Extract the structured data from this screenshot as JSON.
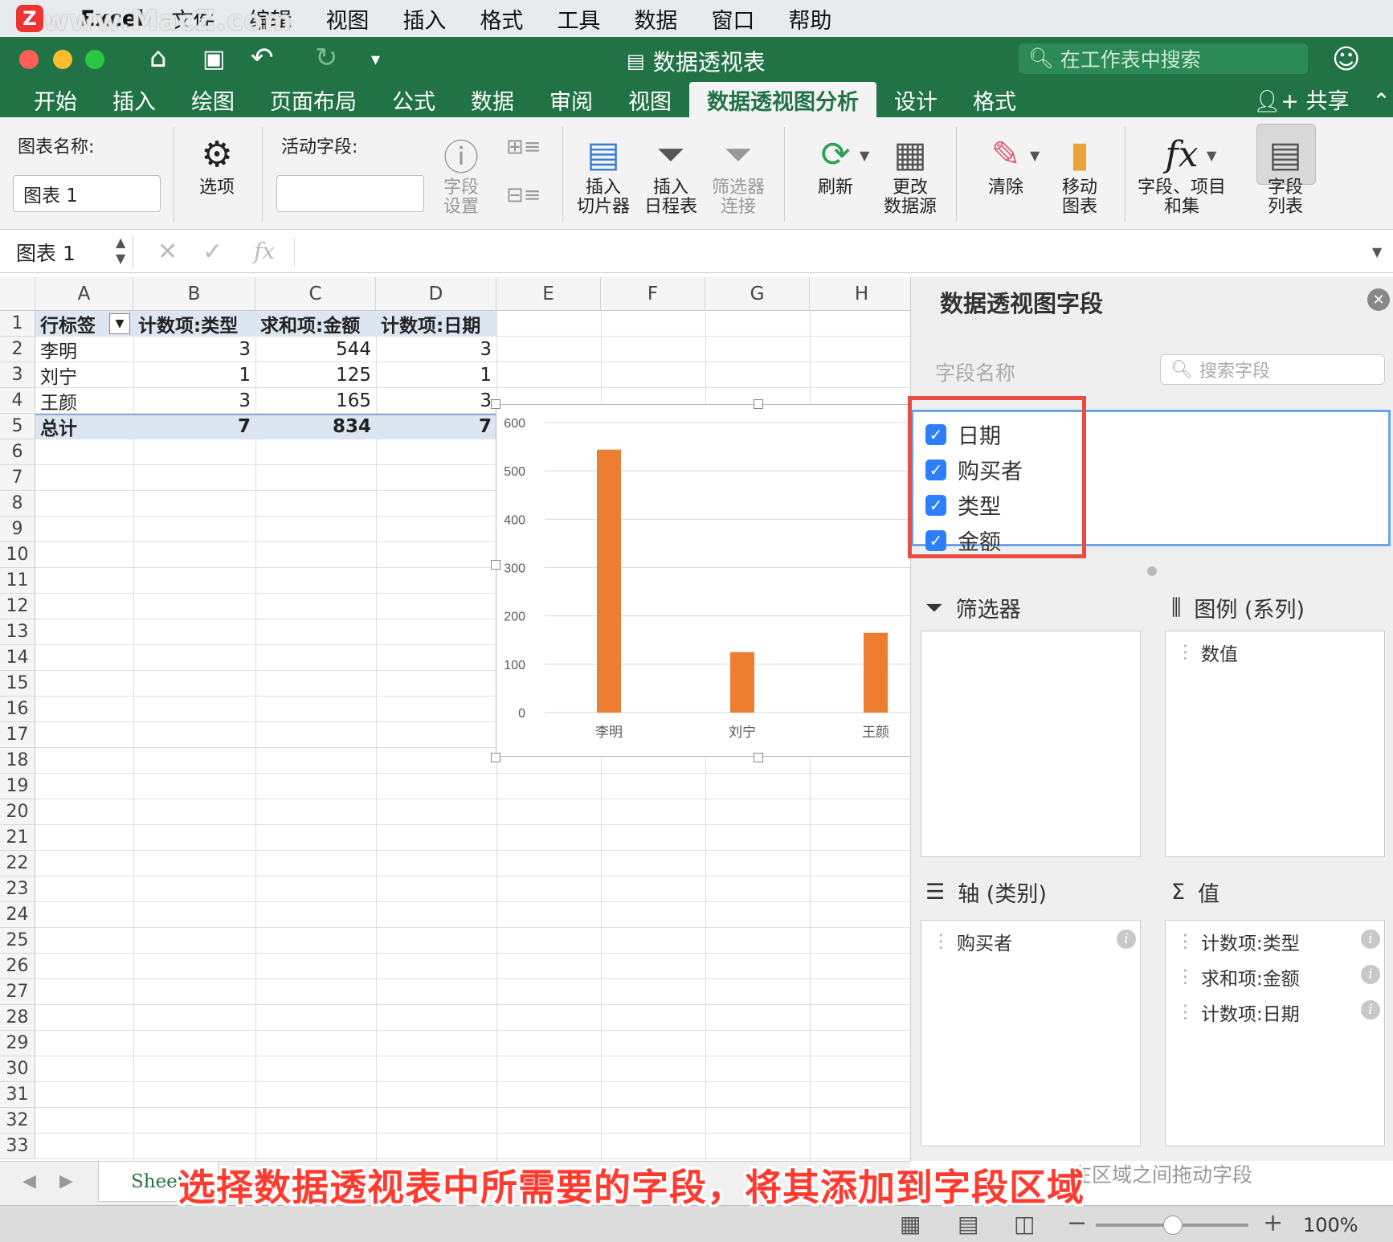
{
  "menubar": {
    "app": "Excel",
    "watermark": "www.MacZ.com",
    "items": [
      "文件",
      "编辑",
      "视图",
      "插入",
      "格式",
      "工具",
      "数据",
      "窗口",
      "帮助"
    ]
  },
  "titlebar": {
    "doc_title": "数据透视表",
    "search_placeholder": "在工作表中搜索"
  },
  "tabs": [
    {
      "label": "开始"
    },
    {
      "label": "插入"
    },
    {
      "label": "绘图"
    },
    {
      "label": "页面布局"
    },
    {
      "label": "公式"
    },
    {
      "label": "数据"
    },
    {
      "label": "审阅"
    },
    {
      "label": "视图"
    },
    {
      "label": "数据透视图分析"
    },
    {
      "label": "设计"
    },
    {
      "label": "格式"
    }
  ],
  "share_label": "共享",
  "ribbon": {
    "chart_name_label": "图表名称:",
    "chart_name_value": "图表 1",
    "options": "选项",
    "active_field_label": "活动字段:",
    "field_settings": "字段\n设置",
    "insert_slicer": "插入\n切片器",
    "insert_timeline": "插入\n日程表",
    "filter_conn": "筛选器\n连接",
    "refresh": "刷新",
    "change_source": "更改\n数据源",
    "clear": "清除",
    "move_chart": "移动\n图表",
    "fields_items": "字段、项目\n和集",
    "field_list": "字段\n列表"
  },
  "formula": {
    "name_box": "图表 1",
    "fx": "fx"
  },
  "grid": {
    "columns": [
      "A",
      "B",
      "C",
      "D",
      "E",
      "F",
      "G",
      "H"
    ],
    "rows": [
      "1",
      "2",
      "3",
      "4",
      "5",
      "6",
      "7",
      "8",
      "9",
      "10",
      "11",
      "12",
      "13",
      "14",
      "15",
      "16",
      "17",
      "18",
      "19",
      "20",
      "21",
      "22",
      "23",
      "24",
      "25",
      "26",
      "27",
      "28",
      "29",
      "30",
      "31",
      "32",
      "33"
    ],
    "header": [
      "行标签",
      "计数项:类型",
      "求和项:金额",
      "计数项:日期"
    ],
    "data": [
      [
        "李明",
        "3",
        "544",
        "3"
      ],
      [
        "刘宁",
        "1",
        "125",
        "1"
      ],
      [
        "王颜",
        "3",
        "165",
        "3"
      ]
    ],
    "total": [
      "总计",
      "7",
      "834",
      "7"
    ]
  },
  "chart_data": {
    "type": "bar",
    "categories": [
      "李明",
      "刘宁",
      "王颜"
    ],
    "values": [
      544,
      125,
      165
    ],
    "ylim": [
      0,
      600
    ],
    "yticks": [
      "600",
      "500",
      "400",
      "300",
      "200",
      "100",
      "0"
    ],
    "color": "#ed7d31"
  },
  "panel": {
    "title": "数据透视图字段",
    "field_name_label": "字段名称",
    "search_placeholder": "搜索字段",
    "fields": [
      "日期",
      "购买者",
      "类型",
      "金额"
    ],
    "filter_label": "筛选器",
    "legend_label": "图例 (系列)",
    "legend_items": [
      "数值"
    ],
    "axis_label": "轴 (类别)",
    "axis_items": [
      "购买者"
    ],
    "values_label": "值",
    "values_items": [
      "计数项:类型",
      "求和项:金额",
      "计数项:日期"
    ],
    "drag_hint": "在区域之间拖动字段"
  },
  "sheet_tab": "Sheet1",
  "caption": "选择数据透视表中所需要的字段，将其添加到字段区域",
  "zoom": "100%"
}
